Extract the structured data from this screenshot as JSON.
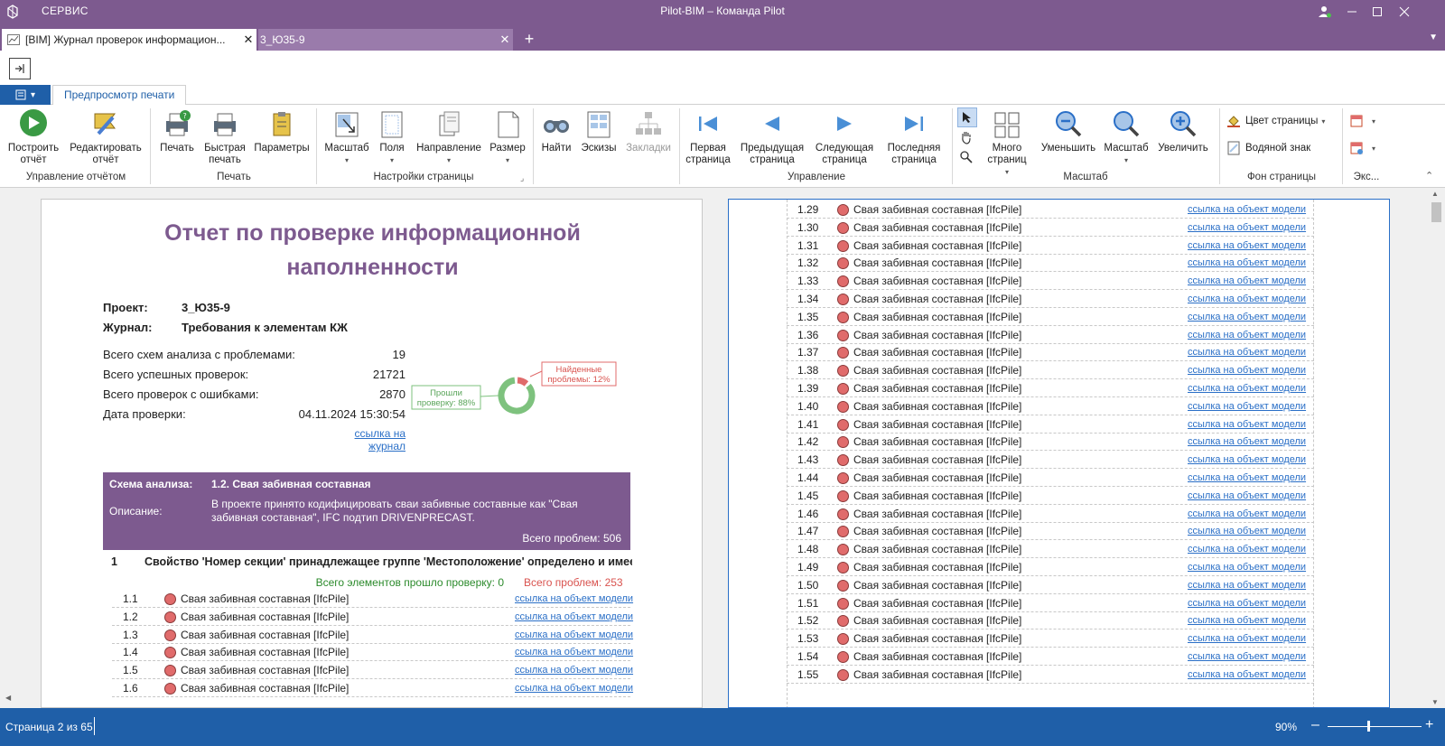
{
  "titlebar": {
    "menu": "СЕРВИС",
    "title": "Pilot-BIM – Команда Pilot"
  },
  "tabs": [
    {
      "label": "[BIM] Журнал проверок информацион...",
      "close": "✕"
    },
    {
      "label": "3_Ю35-9",
      "close": "✕"
    }
  ],
  "tab_add": "+",
  "ribbon_tab": "Предпросмотр печати",
  "ribbon": {
    "build": "Построить отчёт",
    "edit": "Редактировать отчёт",
    "group_report": "Управление отчётом",
    "print": "Печать",
    "quick_print": "Быстрая печать",
    "params": "Параметры",
    "group_print": "Печать",
    "scale": "Масштаб",
    "margins": "Поля",
    "direction": "Направление",
    "size": "Размер",
    "group_page": "Настройки страницы",
    "find": "Найти",
    "thumbs": "Эскизы",
    "bookmarks": "Закладки",
    "first": "Первая страница",
    "prev": "Предыдущая страница",
    "next": "Следующая страница",
    "last": "Последняя страница",
    "group_nav": "Управление",
    "many": "Много страниц",
    "zoom_out": "Уменьшить",
    "zoom": "Масштаб",
    "zoom_in": "Увеличить",
    "group_zoom": "Масштаб",
    "page_color": "Цвет страницы",
    "watermark": "Водяной знак",
    "group_bg": "Фон страницы",
    "group_export": "Экс..."
  },
  "report": {
    "title_line1": "Отчет по проверке информационной",
    "title_line2": "наполненности",
    "project_label": "Проект:",
    "project_value": "3_Ю35-9",
    "journal_label": "Журнал:",
    "journal_value": "Требования к элементам КЖ",
    "stats": [
      {
        "label": "Всего схем анализа с проблемами:",
        "value": "19"
      },
      {
        "label": "Всего успешных проверок:",
        "value": "21721"
      },
      {
        "label": "Всего проверок с ошибками:",
        "value": "2870"
      },
      {
        "label": "Дата проверки:",
        "value": "04.11.2024 15:30:54"
      }
    ],
    "journal_link": "ссылка на журнал",
    "donut": {
      "pass_label_1": "Прошли",
      "pass_label_2": "проверку: 88%",
      "fail_label_1": "Найденные",
      "fail_label_2": "проблемы: 12%",
      "pass_fraction": 0.88,
      "pass_color": "#7ec27e",
      "fail_color": "#e06b6b"
    },
    "scheme_label": "Схема анализа:",
    "scheme_value": "1.2. Свая забивная составная",
    "desc_label": "Описание:",
    "desc_value": "В проекте принято кодифицировать сваи забивные составные как \"Свая забивная составная\", IFC подтип DRIVENPRECAST.",
    "scheme_total": "Всего проблем: 506",
    "section_num": "1",
    "section_title": "Свойство 'Номер секции' принадлежащее группе 'Местоположение' определено и имеет ти",
    "section_ok": "Всего элементов прошло проверку: 0",
    "section_bad": "Всего проблем: 253",
    "rows_p1": [
      {
        "num": "1.1",
        "name": "Свая забивная составная [IfcPile]",
        "link": "ссылка на объект модели"
      },
      {
        "num": "1.2",
        "name": "Свая забивная составная [IfcPile]",
        "link": "ссылка на объект модели"
      },
      {
        "num": "1.3",
        "name": "Свая забивная составная [IfcPile]",
        "link": "ссылка на объект модели"
      },
      {
        "num": "1.4",
        "name": "Свая забивная составная [IfcPile]",
        "link": "ссылка на объект модели"
      },
      {
        "num": "1.5",
        "name": "Свая забивная составная [IfcPile]",
        "link": "ссылка на объект модели"
      },
      {
        "num": "1.6",
        "name": "Свая забивная составная [IfcPile]",
        "link": "ссылка на объект модели"
      }
    ],
    "rows_p2": [
      {
        "num": "1.29",
        "name": "Свая забивная составная [IfcPile]",
        "link": "ссылка на объект модели"
      },
      {
        "num": "1.30",
        "name": "Свая забивная составная [IfcPile]",
        "link": "ссылка на объект модели"
      },
      {
        "num": "1.31",
        "name": "Свая забивная составная [IfcPile]",
        "link": "ссылка на объект модели"
      },
      {
        "num": "1.32",
        "name": "Свая забивная составная [IfcPile]",
        "link": "ссылка на объект модели"
      },
      {
        "num": "1.33",
        "name": "Свая забивная составная [IfcPile]",
        "link": "ссылка на объект модели"
      },
      {
        "num": "1.34",
        "name": "Свая забивная составная [IfcPile]",
        "link": "ссылка на объект модели"
      },
      {
        "num": "1.35",
        "name": "Свая забивная составная [IfcPile]",
        "link": "ссылка на объект модели"
      },
      {
        "num": "1.36",
        "name": "Свая забивная составная [IfcPile]",
        "link": "ссылка на объект модели"
      },
      {
        "num": "1.37",
        "name": "Свая забивная составная [IfcPile]",
        "link": "ссылка на объект модели"
      },
      {
        "num": "1.38",
        "name": "Свая забивная составная [IfcPile]",
        "link": "ссылка на объект модели"
      },
      {
        "num": "1.39",
        "name": "Свая забивная составная [IfcPile]",
        "link": "ссылка на объект модели"
      },
      {
        "num": "1.40",
        "name": "Свая забивная составная [IfcPile]",
        "link": "ссылка на объект модели"
      },
      {
        "num": "1.41",
        "name": "Свая забивная составная [IfcPile]",
        "link": "ссылка на объект модели"
      },
      {
        "num": "1.42",
        "name": "Свая забивная составная [IfcPile]",
        "link": "ссылка на объект модели"
      },
      {
        "num": "1.43",
        "name": "Свая забивная составная [IfcPile]",
        "link": "ссылка на объект модели"
      },
      {
        "num": "1.44",
        "name": "Свая забивная составная [IfcPile]",
        "link": "ссылка на объект модели"
      },
      {
        "num": "1.45",
        "name": "Свая забивная составная [IfcPile]",
        "link": "ссылка на объект модели"
      },
      {
        "num": "1.46",
        "name": "Свая забивная составная [IfcPile]",
        "link": "ссылка на объект модели"
      },
      {
        "num": "1.47",
        "name": "Свая забивная составная [IfcPile]",
        "link": "ссылка на объект модели"
      },
      {
        "num": "1.48",
        "name": "Свая забивная составная [IfcPile]",
        "link": "ссылка на объект модели"
      },
      {
        "num": "1.49",
        "name": "Свая забивная составная [IfcPile]",
        "link": "ссылка на объект модели"
      },
      {
        "num": "1.50",
        "name": "Свая забивная составная [IfcPile]",
        "link": "ссылка на объект модели"
      },
      {
        "num": "1.51",
        "name": "Свая забивная составная [IfcPile]",
        "link": "ссылка на объект модели"
      },
      {
        "num": "1.52",
        "name": "Свая забивная составная [IfcPile]",
        "link": "ссылка на объект модели"
      },
      {
        "num": "1.53",
        "name": "Свая забивная составная [IfcPile]",
        "link": "ссылка на объект модели"
      },
      {
        "num": "1.54",
        "name": "Свая забивная составная [IfcPile]",
        "link": "ссылка на объект модели"
      },
      {
        "num": "1.55",
        "name": "Свая забивная составная [IfcPile]",
        "link": "ссылка на объект модели"
      }
    ]
  },
  "status": {
    "page": "Страница 2 из 65",
    "zoom": "90%",
    "minus": "–",
    "plus": "+"
  }
}
